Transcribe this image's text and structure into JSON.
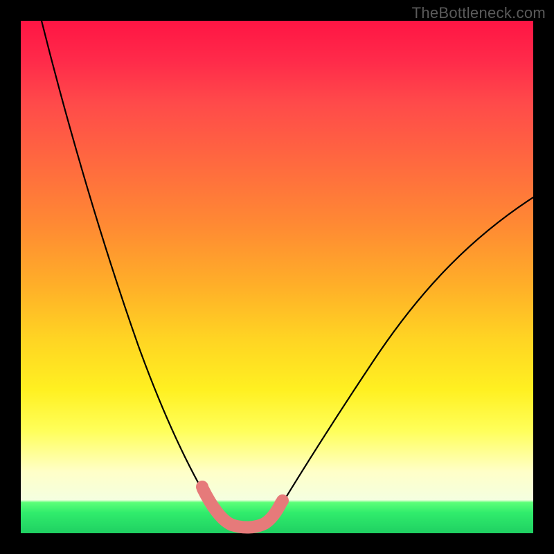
{
  "watermark": "TheBottleneck.com",
  "colors": {
    "page_bg": "#000000",
    "curve": "#000000",
    "highlight": "#e67a7a",
    "gradient_top": "#ff1544",
    "gradient_mid": "#ffff5a",
    "gradient_bottom": "#1fd062"
  },
  "chart_data": {
    "type": "line",
    "title": "",
    "xlabel": "",
    "ylabel": "",
    "xlim": [
      0,
      100
    ],
    "ylim": [
      0,
      100
    ],
    "grid": false,
    "legend": false,
    "annotations": [
      "TheBottleneck.com"
    ],
    "series": [
      {
        "name": "bottleneck-curve",
        "x": [
          4,
          8,
          12,
          16,
          20,
          24,
          28,
          30,
          32,
          34,
          36,
          38,
          40,
          42,
          44,
          46,
          48,
          52,
          56,
          60,
          64,
          68,
          72,
          76,
          80,
          84,
          88,
          92,
          96,
          100
        ],
        "y": [
          100,
          90,
          80,
          70,
          60,
          49,
          37,
          30,
          23,
          16,
          10,
          6,
          3,
          2,
          2,
          3,
          5,
          10,
          16,
          22,
          28,
          34,
          39,
          44,
          49,
          53,
          57,
          60,
          63,
          66
        ]
      },
      {
        "name": "optimal-range-highlight",
        "x": [
          34,
          36,
          38,
          40,
          42,
          44,
          46,
          48
        ],
        "y": [
          16,
          10,
          6,
          3,
          2,
          2,
          3,
          5
        ]
      }
    ]
  }
}
